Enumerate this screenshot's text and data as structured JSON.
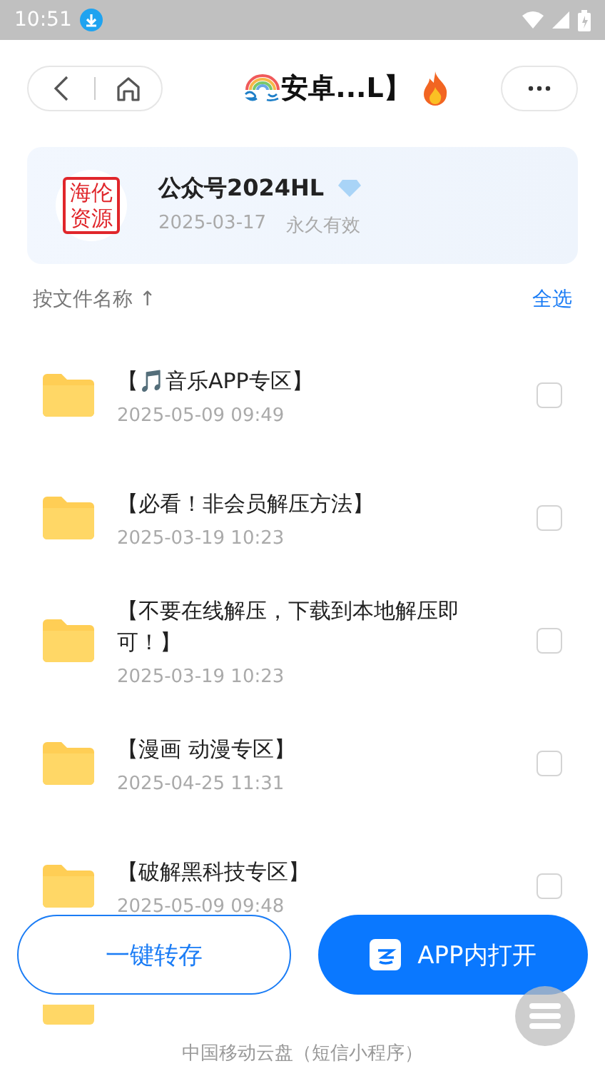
{
  "status_bar": {
    "time": "10:51"
  },
  "nav": {
    "title": "安卓...L】"
  },
  "share_card": {
    "logo_text": "海伦资源",
    "owner": "公众号2024HL",
    "date": "2025-03-17",
    "validity": "永久有效"
  },
  "sort": {
    "label": "按文件名称",
    "arrow": "↑",
    "select_all": "全选"
  },
  "files": [
    {
      "name": "【🎵音乐APP专区】",
      "date": "2025-05-09 09:49",
      "checked": false
    },
    {
      "name": "【必看！非会员解压方法】",
      "date": "2025-03-19 10:23",
      "checked": false
    },
    {
      "name": "【不要在线解压，下载到本地解压即可！】",
      "date": "2025-03-19 10:23",
      "checked": false
    },
    {
      "name": "【漫画 动漫专区】",
      "date": "2025-04-25 11:31",
      "checked": false
    },
    {
      "name": "【破解黑科技专区】",
      "date": "2025-05-09 09:48",
      "checked": false
    }
  ],
  "actions": {
    "save": "一键转存",
    "open_in_app": "APP内打开"
  },
  "footer": "中国移动云盘（短信小程序）"
}
